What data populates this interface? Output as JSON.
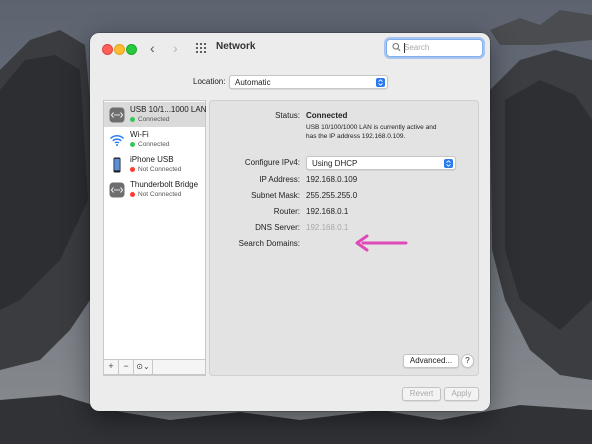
{
  "window": {
    "title": "Network",
    "nav_back": "‹",
    "nav_forward": "›",
    "search_placeholder": "Search"
  },
  "location": {
    "label": "Location:",
    "value": "Automatic"
  },
  "services": [
    {
      "name": "USB 10/1...1000 LAN",
      "status": "Connected",
      "status_color": "#34c759",
      "icon": "ethernet-icon",
      "selected": true
    },
    {
      "name": "Wi-Fi",
      "status": "Connected",
      "status_color": "#34c759",
      "icon": "wifi-icon",
      "selected": false
    },
    {
      "name": "iPhone USB",
      "status": "Not Connected",
      "status_color": "#ff3b30",
      "icon": "iphone-icon",
      "selected": false
    },
    {
      "name": "Thunderbolt Bridge",
      "status": "Not Connected",
      "status_color": "#ff3b30",
      "icon": "ethernet-icon",
      "selected": false
    }
  ],
  "sidebar_controls": {
    "add": "+",
    "remove": "−",
    "actions": "⊙⌄"
  },
  "details": {
    "status_label": "Status:",
    "status_value": "Connected",
    "status_desc_line1": "USB 10/100/1000 LAN is currently active and",
    "status_desc_line2": "has the IP address 192.168.0.109.",
    "configure_label": "Configure IPv4:",
    "configure_value": "Using DHCP",
    "ip_label": "IP Address:",
    "ip_value": "192.168.0.109",
    "subnet_label": "Subnet Mask:",
    "subnet_value": "255.255.255.0",
    "router_label": "Router:",
    "router_value": "192.168.0.1",
    "dns_label": "DNS Server:",
    "dns_value": "192.168.0.1",
    "search_domains_label": "Search Domains:"
  },
  "buttons": {
    "advanced": "Advanced...",
    "help": "?",
    "revert": "Revert",
    "apply": "Apply"
  },
  "colors": {
    "accent": "#2a7bf2",
    "annotation_arrow": "#e04ab8"
  }
}
